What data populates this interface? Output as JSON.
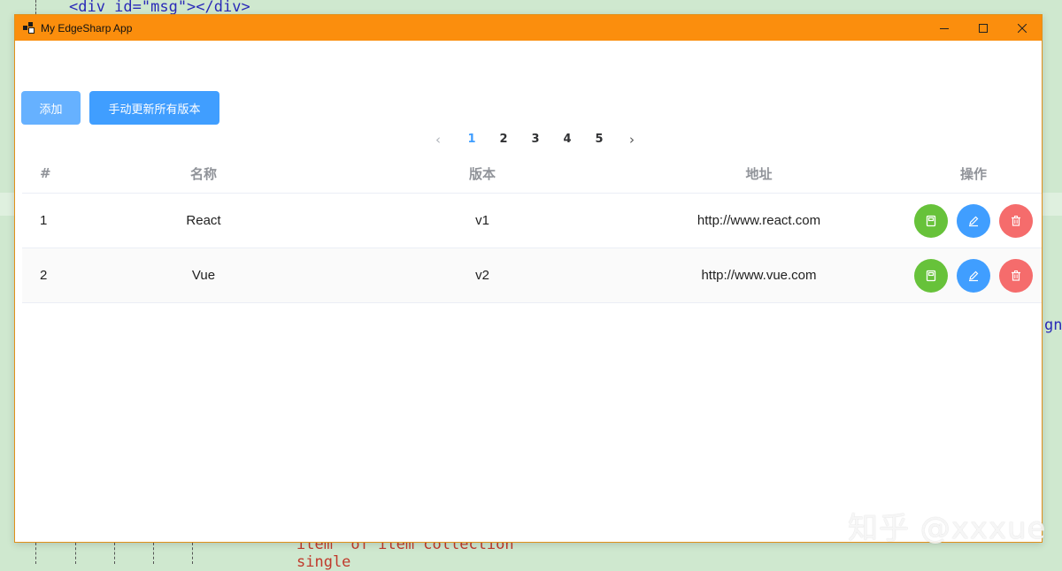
{
  "background_editor": {
    "line_top": "<div id=\"msg\"></div>",
    "line_right": "gn",
    "line_bottom_1": "item\" of item collection",
    "line_bottom_2": "single"
  },
  "window": {
    "title": "My EdgeSharp App",
    "accent": "#fb8e0d"
  },
  "toolbar": {
    "add_label": "添加",
    "update_label": "手动更新所有版本"
  },
  "pagination": {
    "pages": [
      "1",
      "2",
      "3",
      "4",
      "5"
    ],
    "current": "1",
    "prev_icon": "chevron-left-icon",
    "next_icon": "chevron-right-icon"
  },
  "table": {
    "headers": [
      "#",
      "名称",
      "版本",
      "地址",
      "操作"
    ],
    "rows": [
      {
        "idx": "1",
        "name": "React",
        "version": "v1",
        "url": "http://www.react.com"
      },
      {
        "idx": "2",
        "name": "Vue",
        "version": "v2",
        "url": "http://www.vue.com"
      }
    ],
    "actions": [
      {
        "icon": "save-icon",
        "color": "#67c23a"
      },
      {
        "icon": "edit-icon",
        "color": "#409eff"
      },
      {
        "icon": "delete-icon",
        "color": "#f56c6c"
      }
    ]
  },
  "watermark": "知乎 @xxxue"
}
